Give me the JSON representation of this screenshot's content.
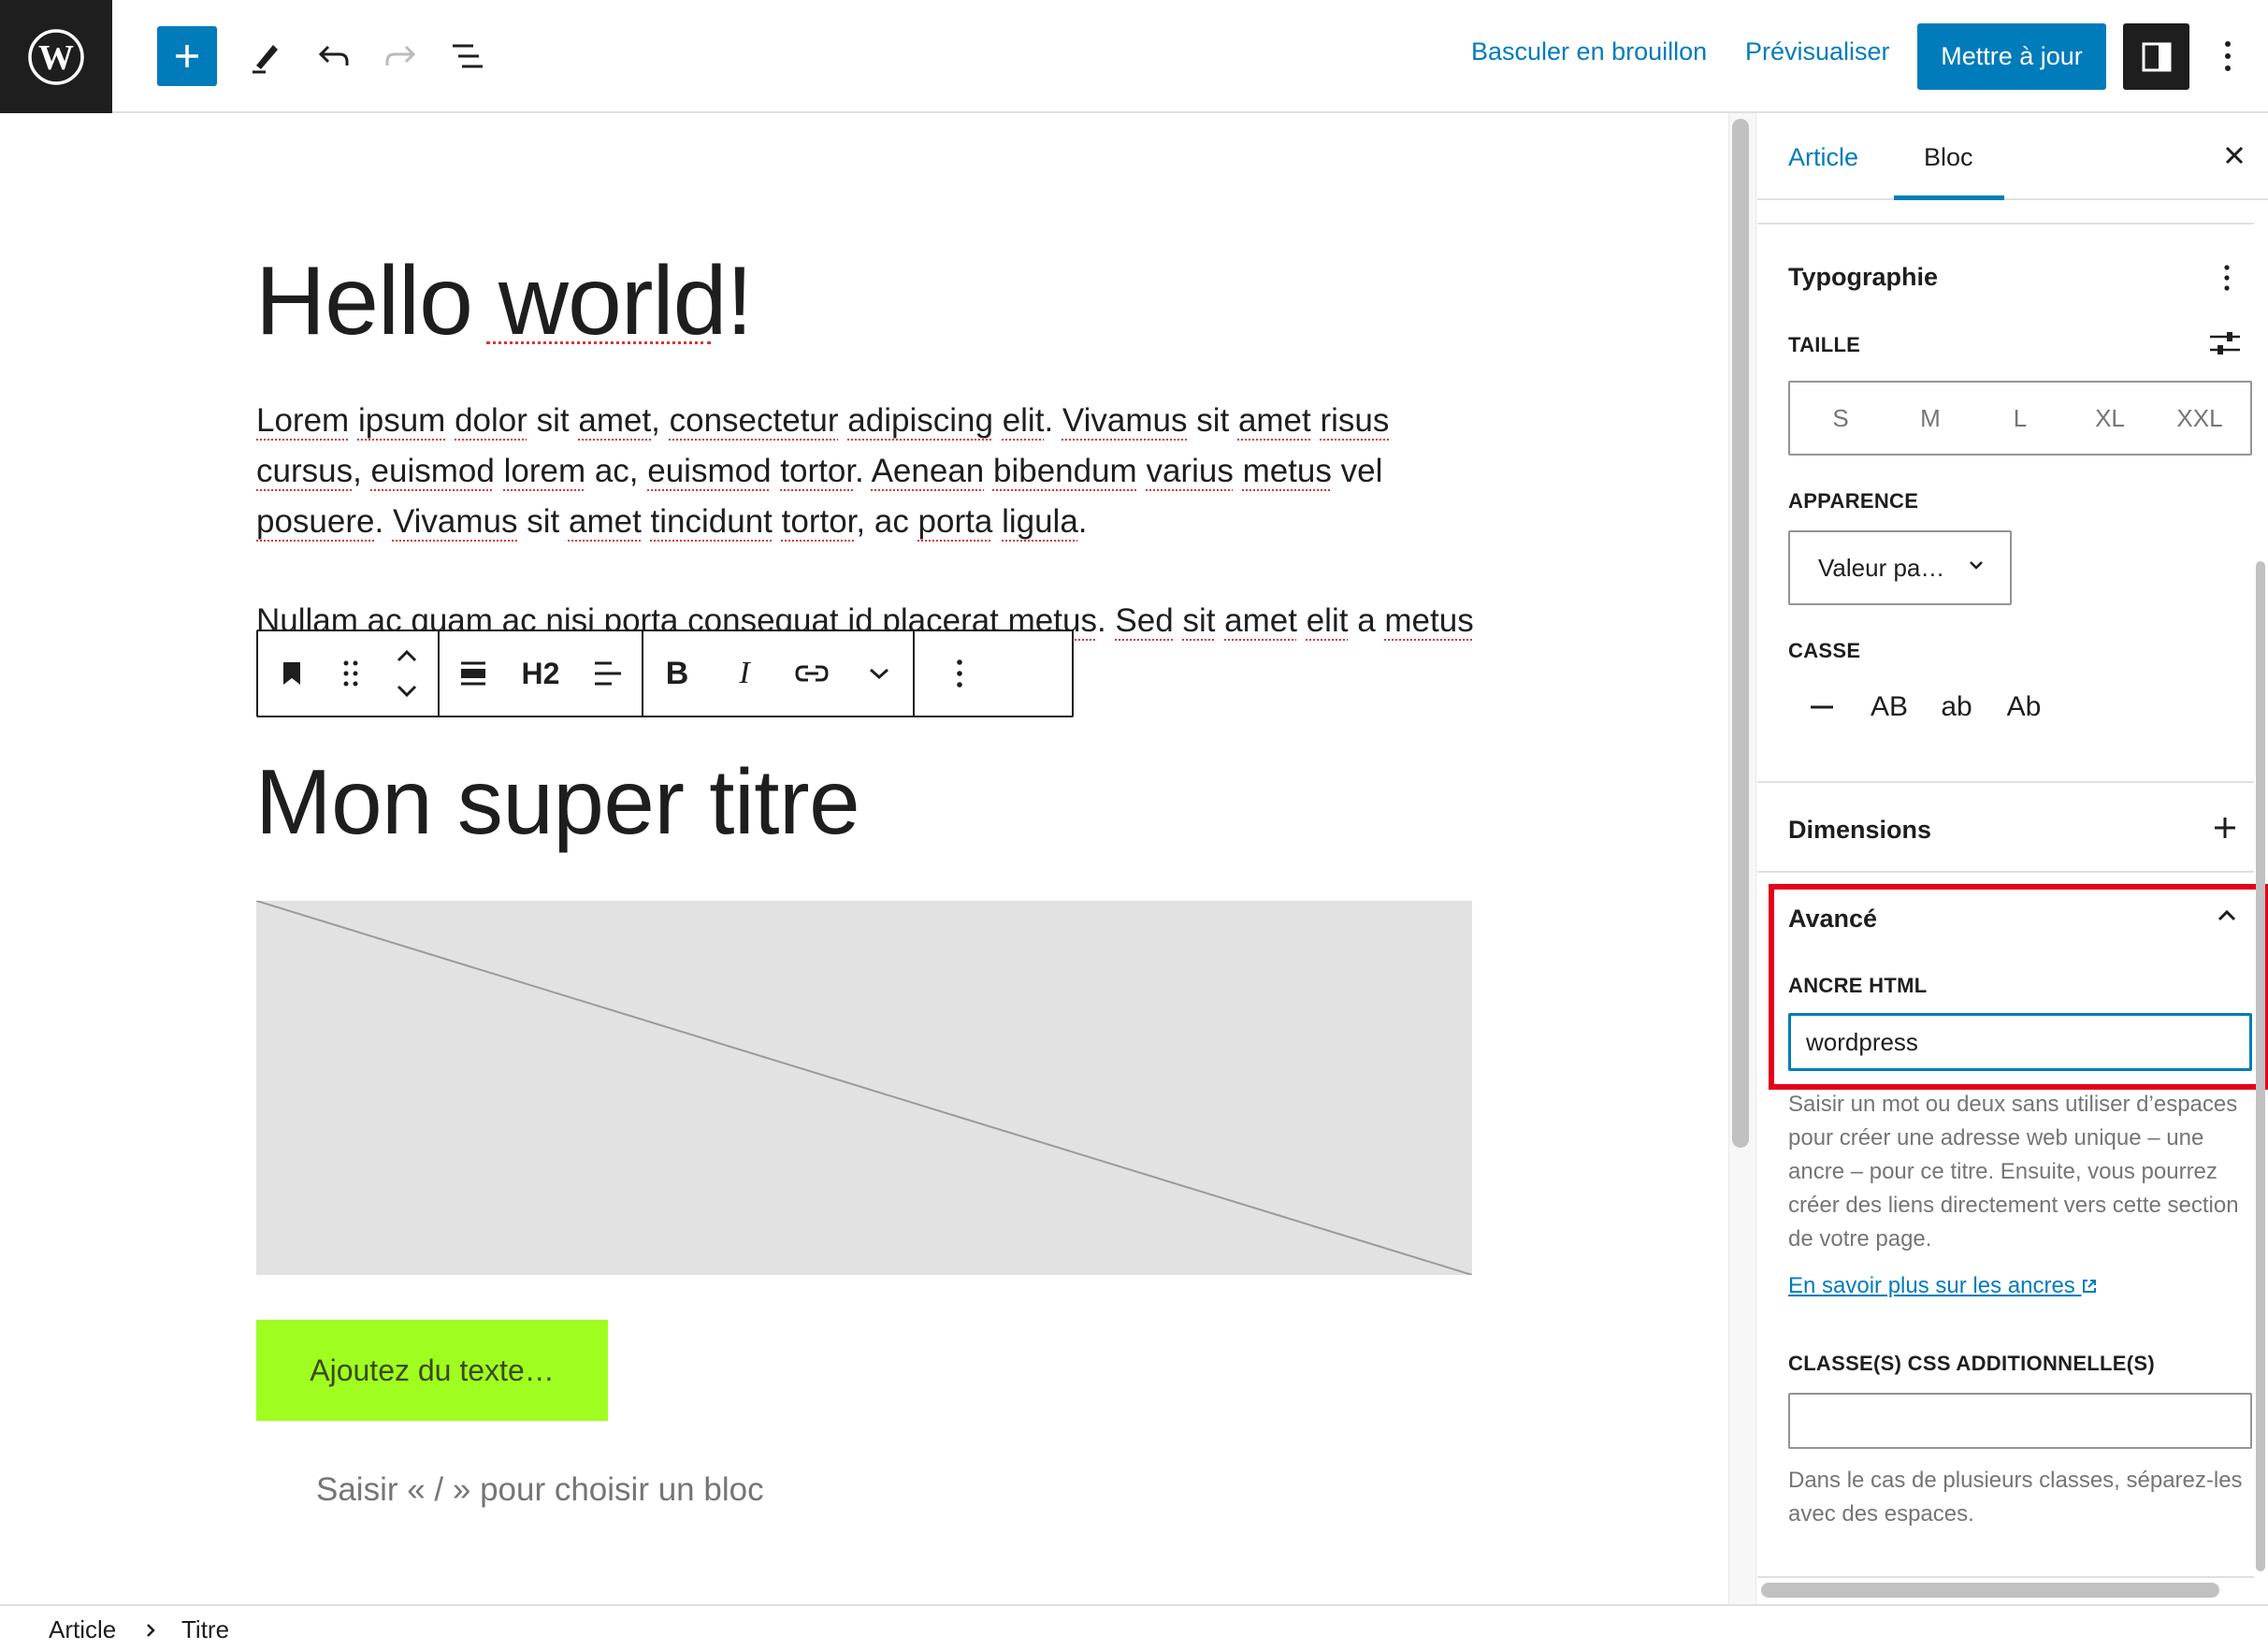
{
  "topbar": {
    "draft_label": "Basculer en brouillon",
    "preview_label": "Prévisualiser",
    "update_label": "Mettre à jour"
  },
  "post": {
    "title": "Hello world!",
    "paragraph1": [
      "Lorem",
      " ",
      "ipsum",
      " ",
      "dolor",
      " ",
      "sit",
      " ",
      "amet",
      ", ",
      "consectetur",
      " ",
      "adipiscing",
      " ",
      "elit",
      ". ",
      "Vivamus",
      " ",
      "sit",
      " ",
      "amet",
      " ",
      "risus",
      " ",
      "cursus",
      ", ",
      "euismod",
      " ",
      "lorem",
      " ac, ",
      "euismod",
      " ",
      "tortor",
      ". ",
      "Aenean",
      " ",
      "bibendum",
      " ",
      "varius",
      " ",
      "metus",
      " ",
      "vel",
      " ",
      "posuere",
      ". ",
      "Vivamus",
      " ",
      "sit",
      " ",
      "amet",
      " ",
      "tincidunt",
      " ",
      "tortor",
      ", ac ",
      "porta",
      " ",
      "ligula",
      "."
    ],
    "paragraph2": [
      "Nullam",
      " ",
      "ac",
      " ",
      "quam",
      " ",
      "ac",
      " ",
      "nisi",
      " ",
      "porta",
      " ",
      "consequat",
      " ",
      "id",
      " ",
      "placerat",
      " ",
      "metus",
      ". ",
      "Sed",
      " ",
      "sit",
      " ",
      "amet",
      " ",
      "elit",
      " a ",
      "metus"
    ],
    "heading": "Mon super titre",
    "button_text": "Ajoutez du texte…",
    "appender_text": "Saisir « / » pour choisir un bloc"
  },
  "block_toolbar": {
    "heading_level": "H2",
    "bold": "B",
    "italic": "I"
  },
  "sidebar": {
    "tabs": [
      "Article",
      "Bloc"
    ],
    "active_tab": "Bloc",
    "typography": {
      "title": "Typographie",
      "size_label": "TAILLE",
      "sizes": [
        "S",
        "M",
        "L",
        "XL",
        "XXL"
      ],
      "appearance_label": "APPARENCE",
      "appearance_value": "Valeur pa…",
      "case_label": "CASSE",
      "case_options": [
        "AB",
        "ab",
        "Ab"
      ]
    },
    "dimensions": {
      "title": "Dimensions"
    },
    "advanced": {
      "title": "Avancé",
      "anchor_label": "ANCRE HTML",
      "anchor_value": "wordpress",
      "anchor_help": "Saisir un mot ou deux sans utiliser d’espaces pour créer une adresse web unique – une ancre – pour ce titre. Ensuite, vous pourrez créer des liens directement vers cette section de votre page.",
      "learn_more": "En savoir plus sur les ancres",
      "css_label": "CLASSE(S) CSS ADDITIONNELLE(S)",
      "css_value": "",
      "css_help": "Dans le cas de plusieurs classes, séparez-les avec des espaces."
    }
  },
  "breadcrumb": [
    "Article",
    "Titre"
  ],
  "colors": {
    "accent": "#007cba",
    "dark": "#1e1e1e",
    "highlight": "#e4001b",
    "button_bg": "#9ffe20",
    "spell_error": "#d63638"
  }
}
